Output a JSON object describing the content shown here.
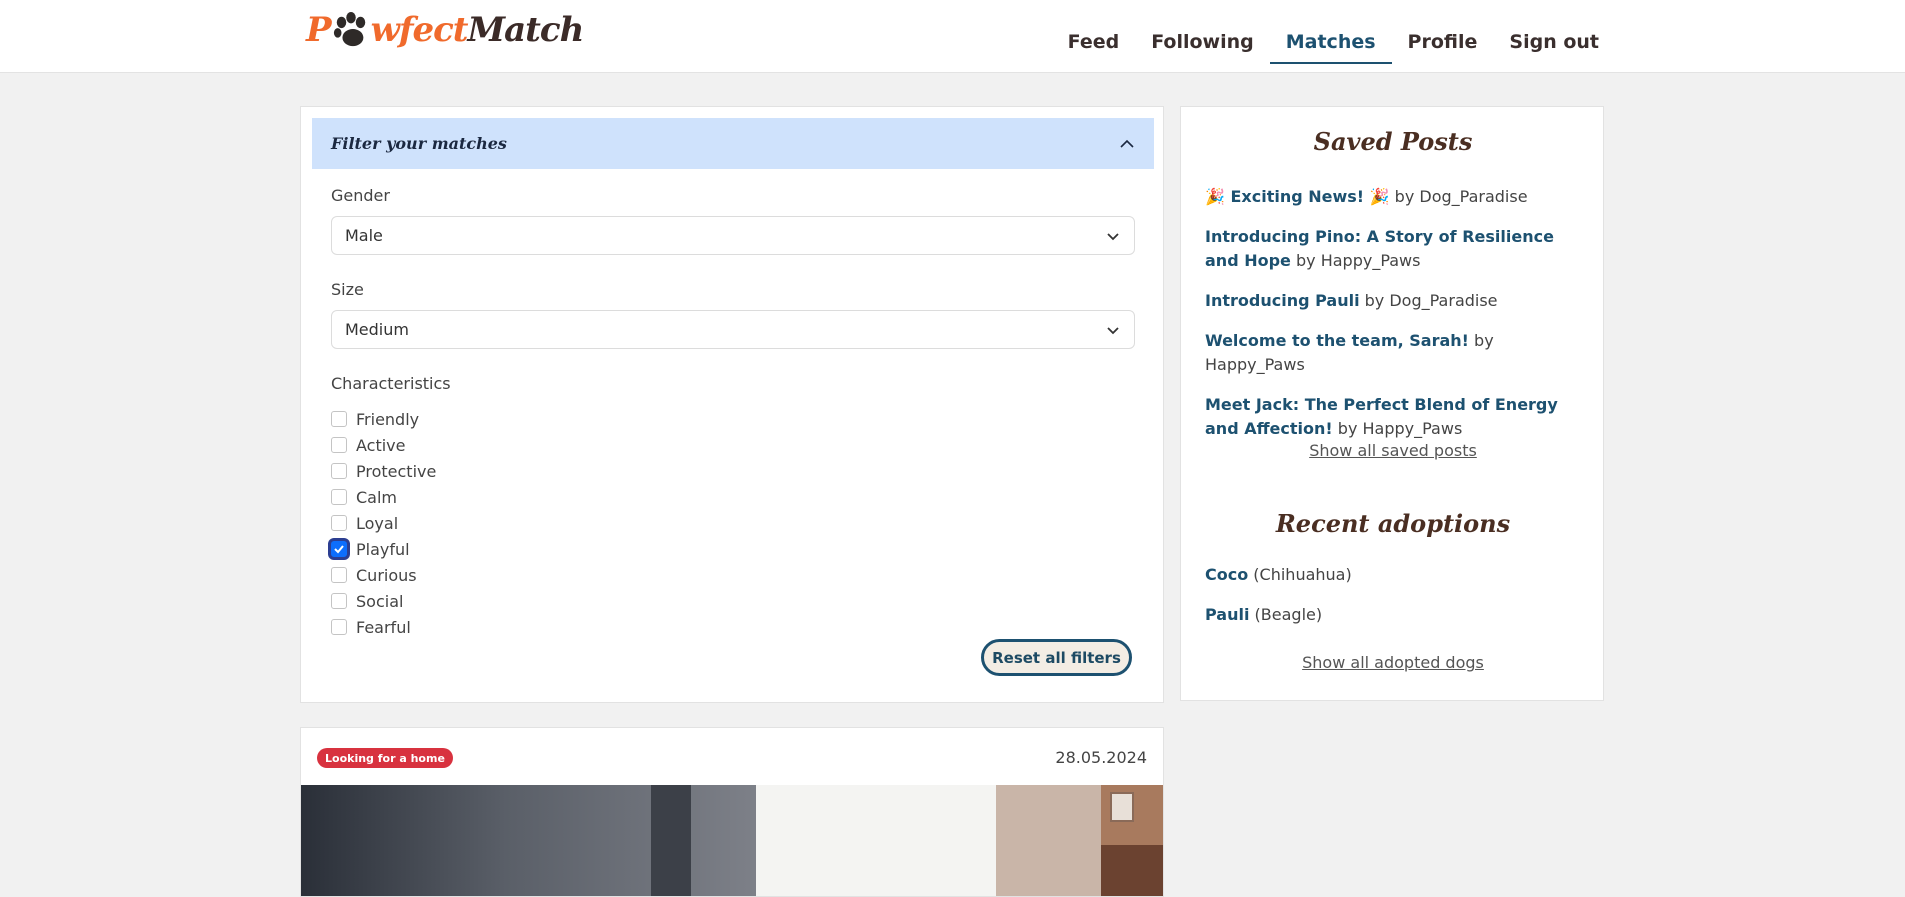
{
  "header": {
    "logo": {
      "part1": "P",
      "part2": "wfect",
      "part3": "Match"
    },
    "nav": [
      "Feed",
      "Following",
      "Matches",
      "Profile",
      "Sign out"
    ],
    "active_nav": "Matches"
  },
  "filters": {
    "title": "Filter your matches",
    "gender": {
      "label": "Gender",
      "value": "Male"
    },
    "size": {
      "label": "Size",
      "value": "Medium"
    },
    "characteristics": {
      "label": "Characteristics",
      "items": [
        {
          "label": "Friendly",
          "checked": false
        },
        {
          "label": "Active",
          "checked": false
        },
        {
          "label": "Protective",
          "checked": false
        },
        {
          "label": "Calm",
          "checked": false
        },
        {
          "label": "Loyal",
          "checked": false
        },
        {
          "label": "Playful",
          "checked": true
        },
        {
          "label": "Curious",
          "checked": false
        },
        {
          "label": "Social",
          "checked": false
        },
        {
          "label": "Fearful",
          "checked": false
        }
      ]
    },
    "reset_label": "Reset all filters"
  },
  "sidebar": {
    "saved_title": "Saved Posts",
    "saved_posts": [
      {
        "title": "🎉 Exciting News! 🎉",
        "by": " by Dog_Paradise"
      },
      {
        "title": "Introducing Pino: A Story of Resilience and Hope",
        "by": " by Happy_Paws"
      },
      {
        "title": "Introducing Pauli",
        "by": " by Dog_Paradise"
      },
      {
        "title": "Welcome to the team, Sarah!",
        "by": " by Happy_Paws"
      },
      {
        "title": "Meet Jack: The Perfect Blend of Energy and Affection!",
        "by": " by Happy_Paws"
      }
    ],
    "show_saved_label": "Show all saved posts",
    "adoptions_title": "Recent adoptions",
    "adoptions": [
      {
        "name": "Coco",
        "breed": " (Chihuahua)"
      },
      {
        "name": "Pauli",
        "breed": " (Beagle)"
      }
    ],
    "show_adopted_label": "Show all adopted dogs"
  },
  "post": {
    "badge": "Looking for a home",
    "date": "28.05.2024"
  },
  "colors": {
    "accent": "#1d5170",
    "logo_orange": "#f06a2c",
    "badge_red": "#d8323f",
    "filter_header": "#cfe2fc"
  }
}
